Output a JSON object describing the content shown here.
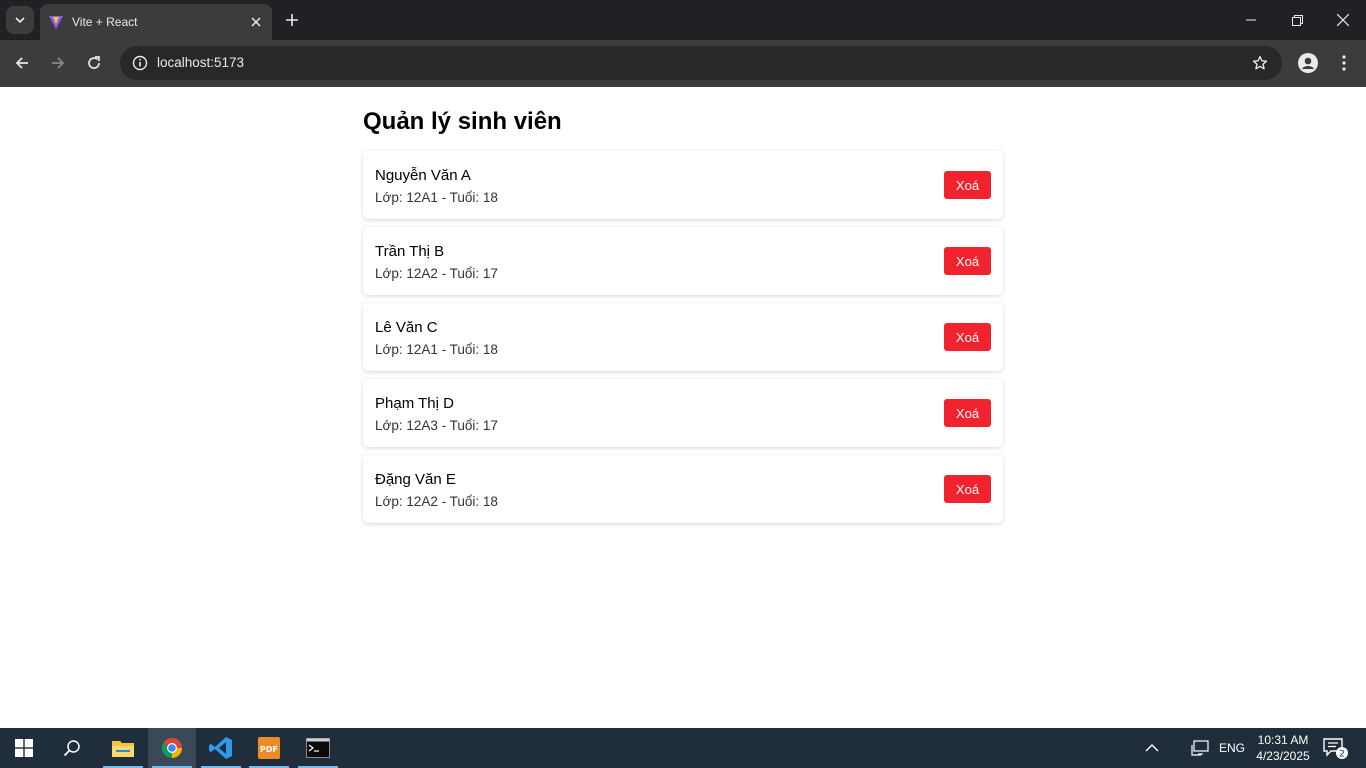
{
  "browser": {
    "tab_title": "Vite + React",
    "url": "localhost:5173"
  },
  "page": {
    "title": "Quản lý sinh viên",
    "students": [
      {
        "name": "Nguyễn Văn A",
        "meta": "Lớp: 12A1 - Tuổi: 18",
        "delete_label": "Xoá"
      },
      {
        "name": "Trần Thị B",
        "meta": "Lớp: 12A2 - Tuổi: 17",
        "delete_label": "Xoá"
      },
      {
        "name": "Lê Văn C",
        "meta": "Lớp: 12A1 - Tuổi: 18",
        "delete_label": "Xoá"
      },
      {
        "name": "Phạm Thị D",
        "meta": "Lớp: 12A3 - Tuổi: 17",
        "delete_label": "Xoá"
      },
      {
        "name": "Đặng Văn E",
        "meta": "Lớp: 12A2 - Tuổi: 18",
        "delete_label": "Xoá"
      }
    ]
  },
  "taskbar": {
    "apps": [
      "start-icon",
      "search-icon",
      "file-explorer-icon",
      "chrome-icon",
      "vscode-icon",
      "pdf-icon",
      "terminal-icon"
    ],
    "language": "ENG",
    "time": "10:31 AM",
    "date": "4/23/2025",
    "notification_count": "2"
  },
  "colors": {
    "delete_button": "#f1232f",
    "chrome_dark": "#202124",
    "taskbar": "#202e3c"
  }
}
